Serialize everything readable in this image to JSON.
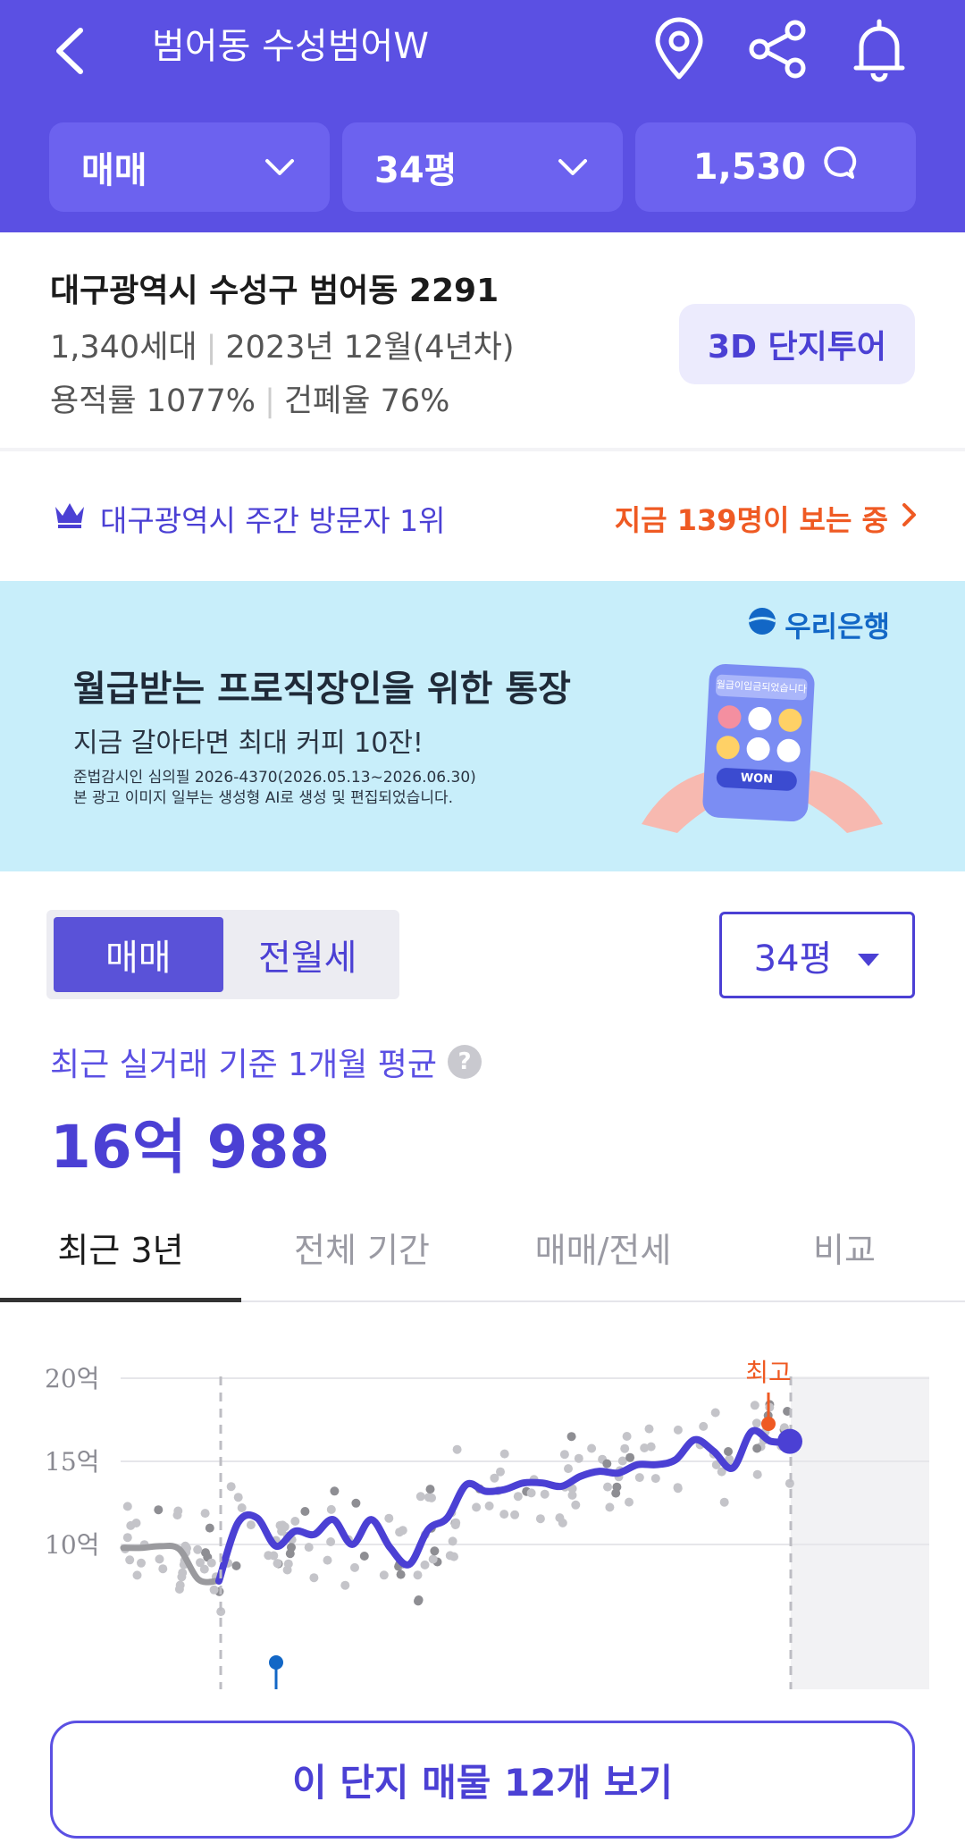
{
  "header": {
    "title": "범어동 수성범어W",
    "filters": {
      "deal_type": "매매",
      "size": "34평",
      "talk_count": "1,530"
    }
  },
  "complex": {
    "address": "대구광역시 수성구 범어동 2291",
    "households": "1,340세대",
    "completion": "2023년 12월(4년차)",
    "floor_area_ratio": "용적률 1077%",
    "building_coverage": "건폐율 76%",
    "tour_button": "3D 단지투어"
  },
  "visitors": {
    "rank_text": "대구광역시 주간 방문자 1위",
    "viewing_text": "지금 139명이 보는 중"
  },
  "ad": {
    "brand": "우리은행",
    "headline": "월급받는 프로직장인을 위한 통장",
    "sub": "지금 갈아타면 최대 커피 10잔!",
    "fine_1": "준법감시인 심의필 2026-4370(2026.05.13~2026.06.30)",
    "fine_2": "본 광고 이미지 일부는 생성형 AI로 생성 및 편집되었습니다.",
    "phone_text": "월급이입금되었습니다",
    "phone_button": "WON"
  },
  "price": {
    "segment": [
      "매매",
      "전월세"
    ],
    "size_select": "34평",
    "avg_label": "최근 실거래 기준 1개월 평균",
    "avg_value": "16억 988"
  },
  "tabs": [
    "최근 3년",
    "전체 기간",
    "매매/전세",
    "비교"
  ],
  "chart_data": {
    "type": "line",
    "y_ticks": [
      "20억",
      "15억",
      "10억"
    ],
    "ylim": [
      6.5,
      20.5
    ],
    "unit": "억",
    "max_label": "최고",
    "series": [
      {
        "values": [
          9.8,
          9.8,
          9.9,
          9.7,
          7.9,
          7.8
        ]
      },
      {
        "values": [
          7.8,
          11.3,
          11.6,
          9.9,
          10.8,
          10.6,
          11.5,
          10.0,
          11.5,
          9.8,
          8.8,
          10.9,
          11.6,
          13.6,
          13.2,
          13.3,
          13.7,
          13.7,
          13.5,
          14.1,
          14.4,
          14.3,
          14.8,
          14.8,
          15.1,
          16.3,
          15.6,
          14.6,
          16.8,
          16.2,
          16.2
        ]
      }
    ],
    "accent_color": "#4b40d4",
    "max_color": "#ef5a23"
  },
  "cta": "이 단지 매물 12개 보기"
}
